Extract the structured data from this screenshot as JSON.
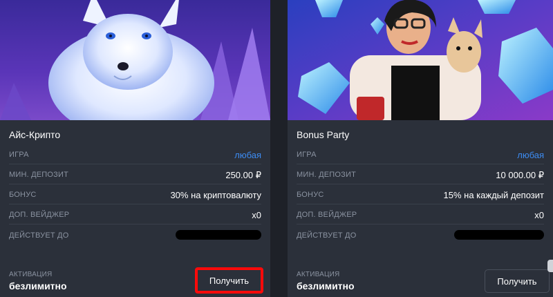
{
  "cards": [
    {
      "title": "Айс-Крипто",
      "rows": [
        {
          "label": "ИГРА",
          "value": "любая"
        },
        {
          "label": "МИН. ДЕПОЗИТ",
          "value": "250.00 ₽"
        },
        {
          "label": "БОНУС",
          "value": "30% на криптовалюту"
        },
        {
          "label": "ДОП. ВЕЙДЖЕР",
          "value": "x0"
        },
        {
          "label": "ДЕЙСТВУЕТ ДО",
          "value": ""
        }
      ],
      "activation_label": "АКТИВАЦИЯ",
      "activation_value": "безлимитно",
      "button_label": "Получить"
    },
    {
      "title": "Bonus Party",
      "rows": [
        {
          "label": "ИГРА",
          "value": "любая"
        },
        {
          "label": "МИН. ДЕПОЗИТ",
          "value": "10 000.00 ₽"
        },
        {
          "label": "БОНУС",
          "value": "15% на каждый депозит"
        },
        {
          "label": "ДОП. ВЕЙДЖЕР",
          "value": "x0"
        },
        {
          "label": "ДЕЙСТВУЕТ ДО",
          "value": ""
        }
      ],
      "activation_label": "АКТИВАЦИЯ",
      "activation_value": "безлимитно",
      "button_label": "Получить"
    }
  ],
  "colors": {
    "card_bg": "#2b303a",
    "link": "#3d8cf2",
    "label": "#8b93a1",
    "highlight": "#ff0a0a"
  }
}
